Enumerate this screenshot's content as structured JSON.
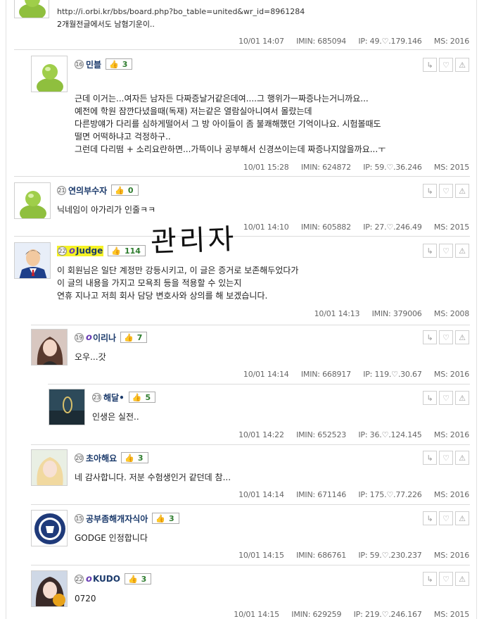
{
  "comments": [
    {
      "id": "c0",
      "level": "",
      "user": "",
      "likes": "",
      "lines": [
        "http://i.orbi.kr/bbs/board.php?bo_table=united&wr_id=8961284",
        "2개월전글에서도 남혐기운이.."
      ],
      "date": "10/01 14:07",
      "imin": "IMIN: 685094",
      "ip": "IP: 49.♡.179.146",
      "ms": "MS: 2016"
    },
    {
      "id": "c1",
      "level": "16",
      "user": "민블",
      "likes": "3",
      "lines": [
        "근데 이거는...여자든 남자든 다짜증날거같은데여....그 행위가ㅡ짜증나는거니까요...",
        "예전에 학원 잠깐다녔을때(독재) 저는같은 열람실아니여서 몰랐는데",
        "다른방얘가 다리를 심하게떨어서 그 방 아이들이 좀 불쾌해했던 기억이나요. 시험볼때도",
        "떨면 어떡하냐고 걱정하구..",
        "그런데 다리떰 + 소리요란하면...가뜩이나 공부해서 신경쓰이는데 짜증나지않을까요...ㅜ"
      ],
      "date": "10/01 15:28",
      "imin": "IMIN: 624872",
      "ip": "IP: 59.♡.36.246",
      "ms": "MS: 2015"
    },
    {
      "id": "c2",
      "level": "21",
      "user": "연의부수자",
      "likes": "0",
      "lines": [
        "닉네임이 아가리가 인줄ㅋㅋ"
      ],
      "date": "10/01 14:10",
      "imin": "IMIN: 605882",
      "ip": "IP: 27.♡.246.49",
      "ms": "MS: 2015"
    },
    {
      "id": "c3",
      "level": "22",
      "user": "Judge",
      "likes": "114",
      "handwriting": "관리자",
      "lines": [
        "이 회원님은 일단 계정만 강등시키고, 이 글은 증거로 보존해두었다가",
        "이 글의 내용을 가지고 모욕죄 등을 적용할 수 있는지",
        "연휴 지나고 저희 회사 담당 변호사와 상의를 해 보겠습니다."
      ],
      "date": "10/01 14:13",
      "imin": "IMIN: 379006",
      "ms": "MS: 2008"
    },
    {
      "id": "c4",
      "level": "19",
      "user": "이리나",
      "likes": "7",
      "lines": [
        "오우...갓"
      ],
      "date": "10/01 14:14",
      "imin": "IMIN: 668917",
      "ip": "IP: 119.♡.30.67",
      "ms": "MS: 2016"
    },
    {
      "id": "c5",
      "level": "23",
      "user": "해달•",
      "likes": "5",
      "lines": [
        "인생은 실전.."
      ],
      "date": "10/01 14:22",
      "imin": "IMIN: 652523",
      "ip": "IP: 36.♡.124.145",
      "ms": "MS: 2016"
    },
    {
      "id": "c6",
      "level": "20",
      "user": "초아해요",
      "likes": "3",
      "lines": [
        "네 감사합니다. 저분 수험생인거 같던데 참..."
      ],
      "date": "10/01 14:14",
      "imin": "IMIN: 671146",
      "ip": "IP: 175.♡.77.226",
      "ms": "MS: 2016"
    },
    {
      "id": "c7",
      "level": "15",
      "user": "공부좀해개자식아",
      "likes": "3",
      "lines": [
        "GODGE 인정합니다"
      ],
      "date": "10/01 14:15",
      "imin": "IMIN: 686761",
      "ip": "IP: 59.♡.230.237",
      "ms": "MS: 2016"
    },
    {
      "id": "c8",
      "level": "22",
      "user": "KUDO",
      "likes": "3",
      "lines": [
        "0720"
      ],
      "date": "10/01 14:15",
      "imin": "IMIN: 629259",
      "ip": "IP: 219.♡.246.167",
      "ms": "MS: 2015"
    }
  ]
}
